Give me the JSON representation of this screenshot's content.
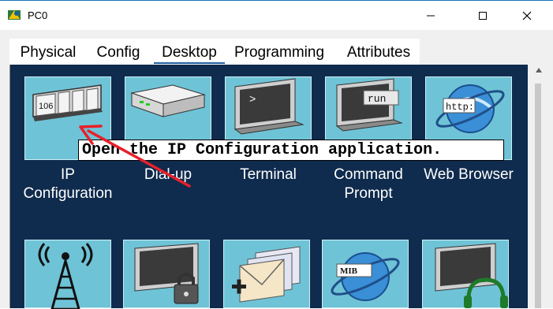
{
  "window": {
    "title": "PC0"
  },
  "tabs": [
    {
      "label": "Physical"
    },
    {
      "label": "Config"
    },
    {
      "label": "Desktop",
      "active": true
    },
    {
      "label": "Programming"
    },
    {
      "label": "Attributes"
    }
  ],
  "apps_row1": [
    {
      "label": "IP\nConfiguration",
      "icon": "ip-configuration-icon",
      "screen_text": "106"
    },
    {
      "label": "Dial-up",
      "icon": "dial-up-icon"
    },
    {
      "label": "Terminal",
      "icon": "terminal-icon",
      "screen_text": ">"
    },
    {
      "label": "Command\nPrompt",
      "icon": "command-prompt-icon",
      "screen_text": "run"
    },
    {
      "label": "Web Browser",
      "icon": "web-browser-icon",
      "screen_text": "http:"
    }
  ],
  "apps_row2": [
    {
      "icon": "wireless-icon"
    },
    {
      "icon": "vpn-icon"
    },
    {
      "icon": "email-icon"
    },
    {
      "icon": "mib-browser-icon",
      "screen_text": "MIB"
    },
    {
      "icon": "pc-headset-icon"
    }
  ],
  "annotation": {
    "text": "Open the IP Configuration application."
  },
  "colors": {
    "panel": "#0f2b4d",
    "tile": "#6fc3d6",
    "arrow": "#e8202a",
    "tab_underline": "#1f5f9f"
  }
}
